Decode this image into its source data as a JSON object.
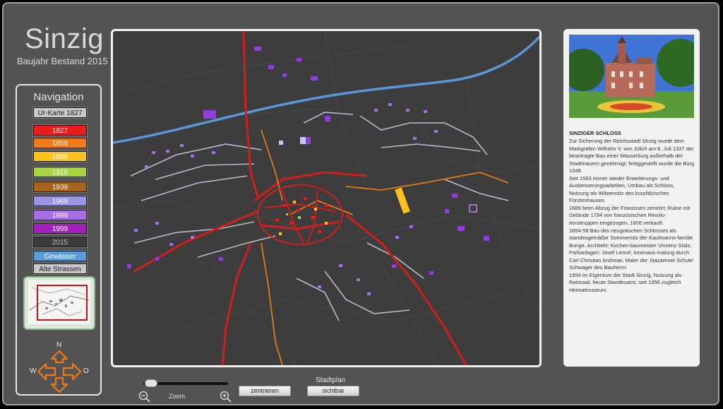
{
  "app": {
    "title": "Sinzig",
    "subtitle": "Baujahr Bestand 2015"
  },
  "navigation": {
    "title": "Navigation",
    "items": [
      {
        "label": "Ur-Karte 1827",
        "color": "#c9c9c9",
        "text_color": "#1a1a1a"
      },
      {
        "label": "1827",
        "color": "#e81a1a",
        "text_color": "#ffffff"
      },
      {
        "label": "1858",
        "color": "#f07a18",
        "text_color": "#ffffff"
      },
      {
        "label": "1895",
        "color": "#ffc21a",
        "text_color": "#ffffff"
      },
      {
        "label": "1916",
        "color": "#a6d63f",
        "text_color": "#ffffff"
      },
      {
        "label": "1939",
        "color": "#a7641e",
        "text_color": "#ffffff"
      },
      {
        "label": "1969",
        "color": "#9b95e6",
        "text_color": "#ffffff"
      },
      {
        "label": "1989",
        "color": "#a86ee8",
        "text_color": "#ffffff"
      },
      {
        "label": "1999",
        "color": "#a51fbf",
        "text_color": "#ffffff"
      },
      {
        "label": "2015",
        "color": "#3b3b3b",
        "text_color": "#bdbdbd"
      },
      {
        "label": "Gewässer",
        "color": "#5b9bd8",
        "text_color": "#ffffff"
      },
      {
        "label": "Alte Strassen",
        "color": "#c9c9c9",
        "text_color": "#1a1a1a"
      }
    ]
  },
  "compass": {
    "north": "N",
    "west": "W",
    "east": "O",
    "south": ""
  },
  "info": {
    "title": "SINZIGER SCHLOSS",
    "text": "Zur Sicherung der Reichsstadt Sinzig wurde dem Markgrafen Wilhelm V. von Jülich am 8. Juli 1337 der beantragte Bau einer Wasserburg außerhalb der Stadtmauern genehmigt; fertiggestellt wurde die Burg 1348.\nSeit 1563 immer wieder Erweiterungs- und Ausbesserungsarbeiten, Umbau als Schloss, Nutzung als Witwensitz des kurpfälzischen Fürstenhauses.\n1689 beim Abzug der Franzosen zerstört; Ruine mit Gelände 1794 von französischen Revolu-tionstruppen eingezogen, 1806 verkauft.\n1854-58 Bau des neugotischen Schlosses als standesgemäßer Sommersitz der Kaufmanns-familie Bunge. Architekt: Kirchen-baumeister Vinzenz Statz, Parkanlagen: Josef Lenné, Innenaus-malung durch Carl Christian Andreae, Maler der ‚Nazarener Schule' Schwager des Bauherrn.\n1954 im Eigentum der Stadt Sinzig, Nutzung als Ratssaal, heute Standesamt, seit 1956 zugleich Heimatmuseum."
  },
  "controls": {
    "zoom_label": "Zoom",
    "center_button": "zentrieren",
    "stadtplan_label": "Stadtplan",
    "visible_button": "sichtbar",
    "zoom_level": 0.05
  },
  "colors": {
    "water": "#5a97d6",
    "old_road": "#d21d1d",
    "road_1858": "#e07a1a",
    "building_modern": "#8f3fe0"
  }
}
